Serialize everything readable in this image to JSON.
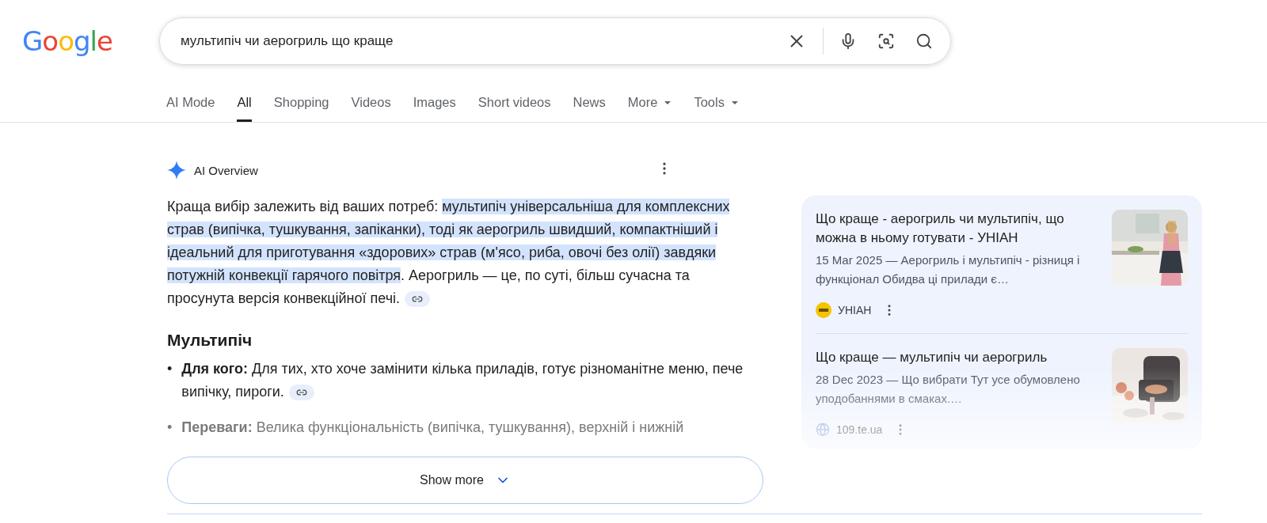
{
  "logo": {
    "letters": [
      {
        "char": "G",
        "color": "#4285f4"
      },
      {
        "char": "o",
        "color": "#ea4335"
      },
      {
        "char": "o",
        "color": "#fbbc05"
      },
      {
        "char": "g",
        "color": "#4285f4"
      },
      {
        "char": "l",
        "color": "#34a853"
      },
      {
        "char": "e",
        "color": "#ea4335"
      }
    ]
  },
  "search": {
    "value": "мультипіч чи аерогриль що краще"
  },
  "tabs": [
    {
      "label": "AI Mode",
      "selected": false,
      "dropdown": false
    },
    {
      "label": "All",
      "selected": true,
      "dropdown": false
    },
    {
      "label": "Shopping",
      "selected": false,
      "dropdown": false
    },
    {
      "label": "Videos",
      "selected": false,
      "dropdown": false
    },
    {
      "label": "Images",
      "selected": false,
      "dropdown": false
    },
    {
      "label": "Short videos",
      "selected": false,
      "dropdown": false
    },
    {
      "label": "News",
      "selected": false,
      "dropdown": false
    },
    {
      "label": "More",
      "selected": false,
      "dropdown": true
    },
    {
      "label": "Tools",
      "selected": false,
      "dropdown": true
    }
  ],
  "ai_overview": {
    "title": "AI Overview",
    "paragraph": [
      {
        "text": "Краща вибір залежить від ваших потреб: ",
        "highlighted": false
      },
      {
        "text": "мультипіч універсальніша для комплексних страв (випічка, тушкування, запіканки), тоді як аерогриль швидший, компактніший і ідеальний для приготування «здорових» страв (м'ясо, риба, овочі без олії) завдяки потужній конвекції гарячого повітря",
        "highlighted": true
      },
      {
        "text": ". Аерогриль — це, по суті, більш сучасна та просунута версія конвекційної печі.",
        "highlighted": false
      }
    ],
    "heading": "Мультипіч",
    "bullets": [
      {
        "marker": "•",
        "text": "**Для кого:** Для тих, хто хоче замінити кілька приладів, готує різноманітне меню, пече випічку, пироги.",
        "link": true
      },
      {
        "marker": "•",
        "text": "**Переваги:** Велика функціональність (випічка, тушкування), верхній і нижній",
        "link": false
      }
    ],
    "show_more": "Show more",
    "sources": [
      {
        "title": "Що краще - аерогриль чи мультипіч, що можна в ньому готувати - УНІАН",
        "snippet": "15 Mar 2025 — Аерогриль і мультипіч - різниця і функціонал Обидва ці прилади є…",
        "source": "УНІАН",
        "kind": "picture"
      },
      {
        "title": "Що краще — мультипіч чи аерогриль",
        "snippet": "28 Dec 2023 — Що вибрати Тут усе обумовлено уподобаннями в смаках.…",
        "source": "109.te.ua",
        "kind": "picture"
      }
    ]
  }
}
